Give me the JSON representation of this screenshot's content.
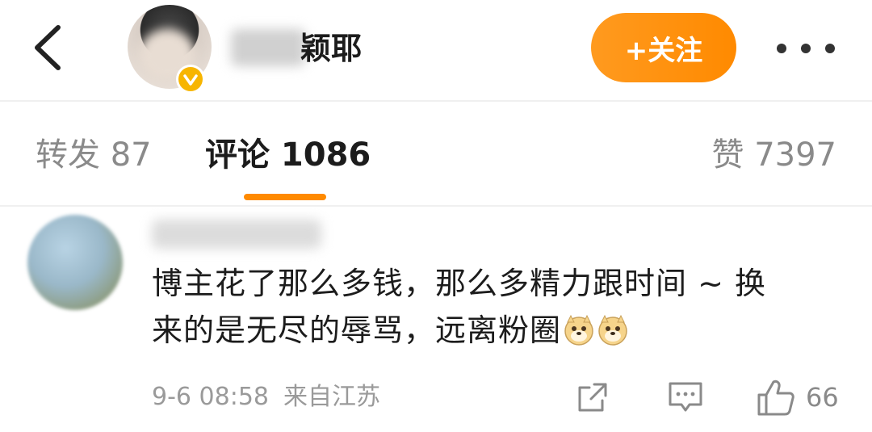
{
  "header": {
    "username_visible": "颖耶",
    "follow_label": "+关注"
  },
  "tabs": [
    {
      "label": "转发 87"
    },
    {
      "label": "评论 1086"
    },
    {
      "label": "赞 7397"
    }
  ],
  "comment": {
    "line1": "博主花了那么多钱，那么多精力跟时间 ~ 换",
    "line2": "来的是无尽的辱骂，远离粉圈",
    "timestamp": "9-6 08:58",
    "location": "来自江苏",
    "like_count": "66"
  },
  "colors": {
    "accent": "#ff8a00",
    "verified": "#f7b500"
  },
  "icons": [
    "back-arrow-icon",
    "verified-badge-icon",
    "more-icon",
    "share-icon",
    "reply-icon",
    "like-icon",
    "doge-emoji-icon"
  ]
}
